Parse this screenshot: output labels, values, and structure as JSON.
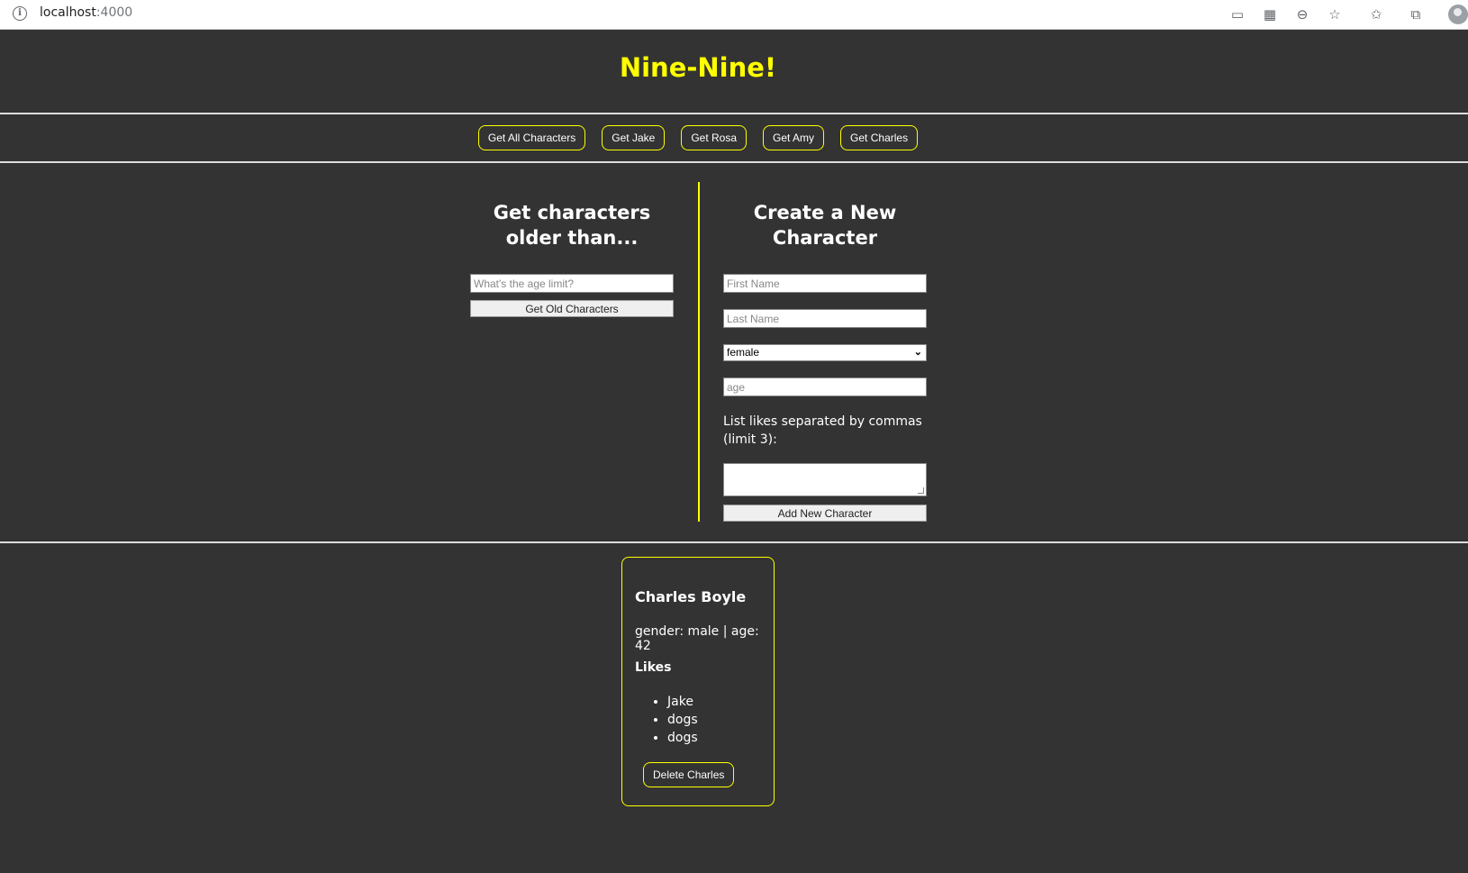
{
  "browser": {
    "url_host": "localhost",
    "url_port": ":4000"
  },
  "page": {
    "title": "Nine-Nine!",
    "accent_color": "#ffff00",
    "background_color": "#333333"
  },
  "nav": {
    "buttons": [
      "Get All Characters",
      "Get Jake",
      "Get Rosa",
      "Get Amy",
      "Get Charles"
    ]
  },
  "older_section": {
    "heading": "Get characters older than...",
    "age_placeholder": "What's the age limit?",
    "submit_label": "Get Old Characters"
  },
  "create_section": {
    "heading": "Create a New Character",
    "first_name_placeholder": "First Name",
    "last_name_placeholder": "Last Name",
    "gender_selected": "female",
    "age_placeholder": "age",
    "likes_label": "List likes separated by commas (limit 3):",
    "submit_label": "Add New Character"
  },
  "character_card": {
    "name": "Charles Boyle",
    "meta": "gender: male | age: 42",
    "likes_heading": "Likes",
    "likes": [
      "Jake",
      "dogs",
      "dogs"
    ],
    "delete_label": "Delete Charles"
  }
}
